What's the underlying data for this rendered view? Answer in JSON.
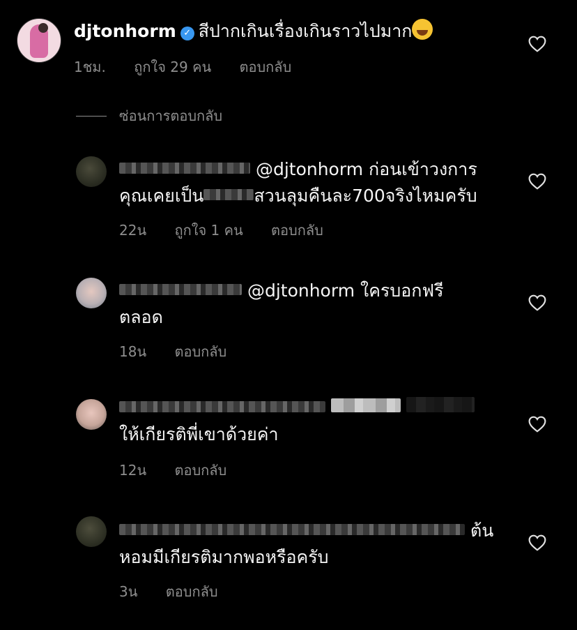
{
  "main_comment": {
    "username": "djtonhorm",
    "text": "สีปากเกินเรื่องเกินราวไปมาก",
    "time": "1ชม.",
    "likes": "ถูกใจ 29 คน",
    "reply": "ตอบกลับ"
  },
  "hide_replies_label": "ซ่อนการตอบกลับ",
  "replies": [
    {
      "mention": "@djtonhorm",
      "text_line1": "ก่อนเข้าวงการ",
      "text_line2a": "คุณเคยเป็น",
      "text_line2b": "สวนลุมคืนละ700จริงไหมครับ",
      "time": "22น",
      "likes": "ถูกใจ 1 คน",
      "reply": "ตอบกลับ"
    },
    {
      "mention": "@djtonhorm",
      "text_line1": "ใครบอกฟรี",
      "text_line2": "ตลอด",
      "time": "18น",
      "reply": "ตอบกลับ"
    },
    {
      "text_line2": "ให้เกียรติพี่เขาด้วยค่า",
      "time": "12น",
      "reply": "ตอบกลับ"
    },
    {
      "text_line1": "ต้น",
      "text_line2": "หอมมีเกียรติมากพอหรือครับ",
      "time": "3น",
      "reply": "ตอบกลับ"
    }
  ],
  "colors": {
    "background": "#000000",
    "text": "#f5f5f5",
    "secondary": "#8e8e8e",
    "verified": "#3897f0"
  },
  "icons": [
    "heart-icon",
    "verified-badge-icon",
    "laughing-emoji-icon"
  ]
}
